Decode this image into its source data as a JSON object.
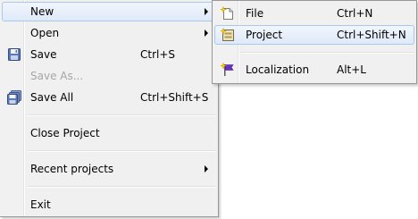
{
  "menu": {
    "new": {
      "label": "New",
      "icon": "chevron-right"
    },
    "open": {
      "label": "Open",
      "icon": "chevron-right"
    },
    "save": {
      "label": "Save",
      "shortcut": "Ctrl+S",
      "icon": "save-icon"
    },
    "save_as": {
      "label": "Save As...",
      "disabled": true
    },
    "save_all": {
      "label": "Save All",
      "shortcut": "Ctrl+Shift+S",
      "icon": "save-all-icon"
    },
    "close_project": {
      "label": "Close Project"
    },
    "recent_projects": {
      "label": "Recent projects",
      "icon": "chevron-right"
    },
    "exit": {
      "label": "Exit"
    }
  },
  "submenu_new": {
    "file": {
      "label": "File",
      "shortcut": "Ctrl+N",
      "icon": "new-file-icon"
    },
    "project": {
      "label": "Project",
      "shortcut": "Ctrl+Shift+N",
      "icon": "new-project-icon",
      "highlighted": true
    },
    "localization": {
      "label": "Localization",
      "shortcut": "Alt+L",
      "icon": "localization-flag-icon"
    }
  },
  "colors": {
    "menu_bg": "#f0f0f0",
    "highlight_border": "#a8c8f0",
    "highlight_fill": "#dfe9f8",
    "disabled_text": "#a6a6a6"
  }
}
